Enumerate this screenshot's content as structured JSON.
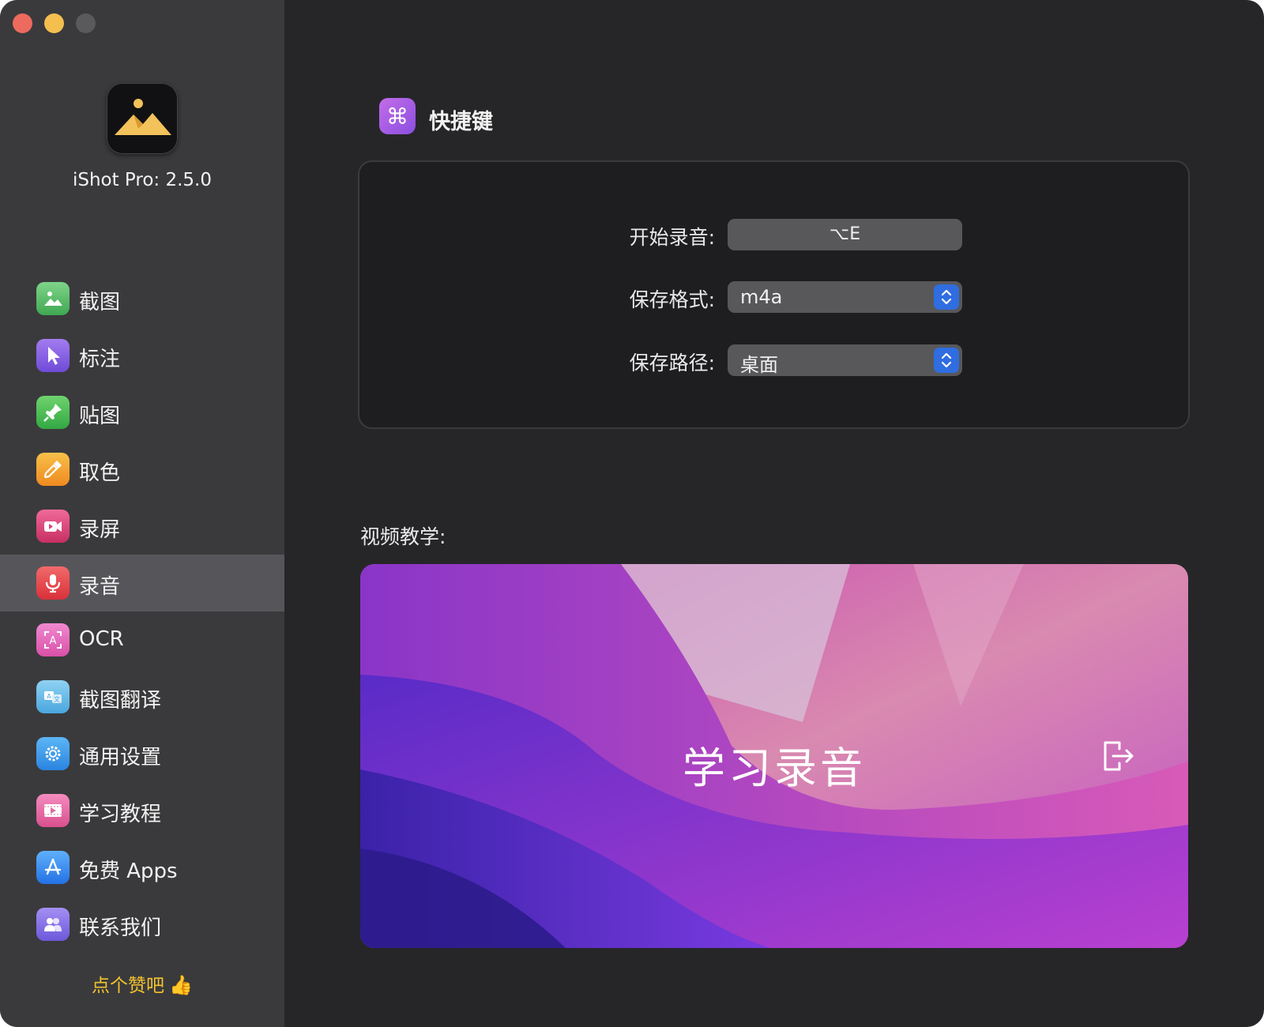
{
  "app": {
    "title": "iShot Pro: 2.5.0"
  },
  "sidebar": {
    "items": [
      {
        "label": "截图",
        "icon": "image-icon",
        "color": "#5fbf6a",
        "active": false
      },
      {
        "label": "标注",
        "icon": "cursor-arrow-icon",
        "color": "#8b63e6",
        "active": false
      },
      {
        "label": "贴图",
        "icon": "pin-icon",
        "color": "#4fbf5a",
        "active": false
      },
      {
        "label": "取色",
        "icon": "eyedropper-icon",
        "color": "#f0a020",
        "active": false
      },
      {
        "label": "录屏",
        "icon": "video-camera-icon",
        "color": "#e0457a",
        "active": false
      },
      {
        "label": "录音",
        "icon": "microphone-icon",
        "color": "#e8454d",
        "active": true
      },
      {
        "label": "OCR",
        "icon": "ocr-text-icon",
        "color": "#e36db5",
        "active": false
      },
      {
        "label": "截图翻译",
        "icon": "translate-icon",
        "color": "#5bb8e8",
        "active": false
      },
      {
        "label": "通用设置",
        "icon": "gear-icon",
        "color": "#3a9be8",
        "active": false
      },
      {
        "label": "学习教程",
        "icon": "film-icon",
        "color": "#e56fa8",
        "active": false
      },
      {
        "label": "免费 Apps",
        "icon": "app-store-icon",
        "color": "#3a86f0",
        "active": false
      },
      {
        "label": "联系我们",
        "icon": "contacts-icon",
        "color": "#8b72e8",
        "active": false
      }
    ],
    "like_text": "点个赞吧",
    "like_emoji": "👍"
  },
  "main": {
    "section_title": "快捷键",
    "section_icon": "command-icon",
    "rows": {
      "start_record": {
        "label": "开始录音:",
        "value": "⌥E"
      },
      "save_format": {
        "label": "保存格式:",
        "value": "m4a"
      },
      "save_path": {
        "label": "保存路径:",
        "value": "桌面"
      }
    },
    "video": {
      "label": "视频教学:",
      "title": "学习录音"
    }
  },
  "colors": {
    "accent_blue": "#2f6de0",
    "like_yellow": "#f2c230"
  }
}
